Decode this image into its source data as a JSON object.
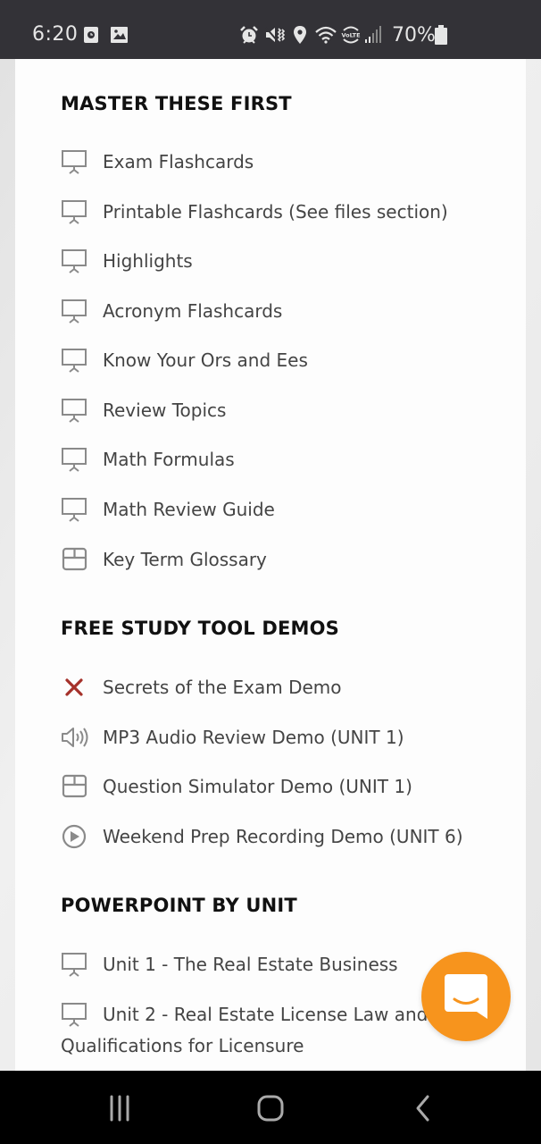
{
  "status_bar": {
    "time": "6:20",
    "left_icons": [
      "screen-recorder-icon",
      "gallery-icon"
    ],
    "right_icons": [
      "alarm-icon",
      "mute-vibrate-icon",
      "location-icon",
      "wifi-icon",
      "volte-icon",
      "signal-icon"
    ],
    "battery": "70%"
  },
  "sections": [
    {
      "title": "MASTER THESE FIRST",
      "items": [
        {
          "label": "Exam Flashcards",
          "icon": "presentation-icon"
        },
        {
          "label": "Printable Flashcards (See files section)",
          "icon": "presentation-icon"
        },
        {
          "label": "Highlights",
          "icon": "presentation-icon"
        },
        {
          "label": "Acronym Flashcards",
          "icon": "presentation-icon"
        },
        {
          "label": "Know Your Ors and Ees",
          "icon": "presentation-icon"
        },
        {
          "label": "Review Topics",
          "icon": "presentation-icon"
        },
        {
          "label": "Math Formulas",
          "icon": "presentation-icon"
        },
        {
          "label": "Math Review Guide",
          "icon": "presentation-icon"
        },
        {
          "label": "Key Term Glossary",
          "icon": "box-icon"
        }
      ]
    },
    {
      "title": "FREE STUDY TOOL DEMOS",
      "items": [
        {
          "label": "Secrets of the Exam Demo",
          "icon": "close-x-icon"
        },
        {
          "label": "MP3 Audio Review Demo (UNIT 1)",
          "icon": "speaker-icon"
        },
        {
          "label": "Question Simulator Demo (UNIT 1)",
          "icon": "box-icon"
        },
        {
          "label": "Weekend Prep Recording Demo (UNIT 6)",
          "icon": "play-circle-icon"
        }
      ]
    },
    {
      "title": "POWERPOINT BY UNIT",
      "items": [
        {
          "label": "Unit 1 - The Real Estate Business",
          "icon": "presentation-icon"
        },
        {
          "label": "Unit 2 - Real Estate License Law and",
          "label_cont": "Qualifications for Licensure",
          "icon": "presentation-icon"
        }
      ]
    }
  ],
  "chat_button": {
    "icon": "chat-smile-icon",
    "color": "#f7941d"
  },
  "nav_bar": {
    "buttons": [
      "recent-apps-icon",
      "home-icon",
      "back-icon"
    ]
  },
  "colors": {
    "x_icon": "#a5312a",
    "icon_grey": "#8a8a8a",
    "text": "#444444",
    "heading": "#111111"
  }
}
